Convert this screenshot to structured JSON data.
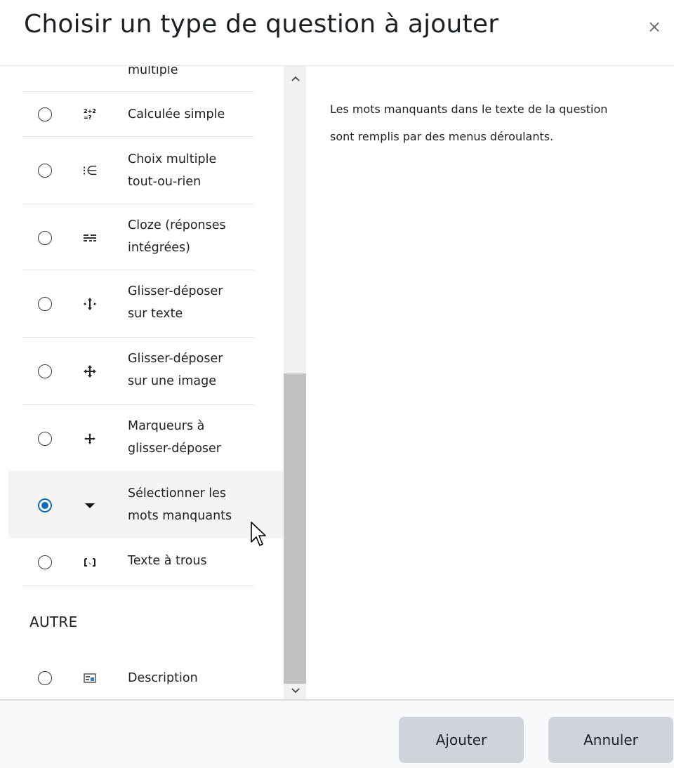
{
  "dialog": {
    "title": "Choisir un type de question à ajouter",
    "close_label": "×"
  },
  "options": [
    {
      "label_lines": [
        "multiple"
      ],
      "icon": "partial-icon",
      "selected": false
    },
    {
      "label_lines": [
        "Calculée simple"
      ],
      "icon": "calculated-simple-icon",
      "icon_text": "2+2\n=?",
      "selected": false
    },
    {
      "label_lines": [
        "Choix multiple",
        "tout-ou-rien"
      ],
      "icon": "multichoice-set-icon",
      "icon_text": "⁝∈",
      "selected": false
    },
    {
      "label_lines": [
        "Cloze (réponses",
        "intégrées)"
      ],
      "icon": "cloze-icon",
      "selected": false
    },
    {
      "label_lines": [
        "Glisser-déposer",
        "sur texte"
      ],
      "icon": "drag-drop-text-icon",
      "selected": false
    },
    {
      "label_lines": [
        "Glisser-déposer",
        "sur une image"
      ],
      "icon": "drag-drop-image-icon",
      "selected": false
    },
    {
      "label_lines": [
        "Marqueurs à",
        "glisser-déposer"
      ],
      "icon": "drag-drop-markers-icon",
      "selected": false
    },
    {
      "label_lines": [
        "Sélectionner les",
        "mots manquants"
      ],
      "icon": "select-missing-words-icon",
      "selected": true
    },
    {
      "label_lines": [
        "Texte à trous"
      ],
      "icon": "gapfill-icon",
      "selected": false
    }
  ],
  "section_other": "AUTRE",
  "other_options": [
    {
      "label_lines": [
        "Description"
      ],
      "icon": "description-icon",
      "selected": false
    }
  ],
  "description": "Les mots manquants dans le texte de la question sont remplis par des menus déroulants.",
  "buttons": {
    "add": "Ajouter",
    "cancel": "Annuler"
  },
  "colors": {
    "accent": "#0f6cbf",
    "button_bg": "#ced4da",
    "selected_row_bg": "#f4f4f4"
  }
}
